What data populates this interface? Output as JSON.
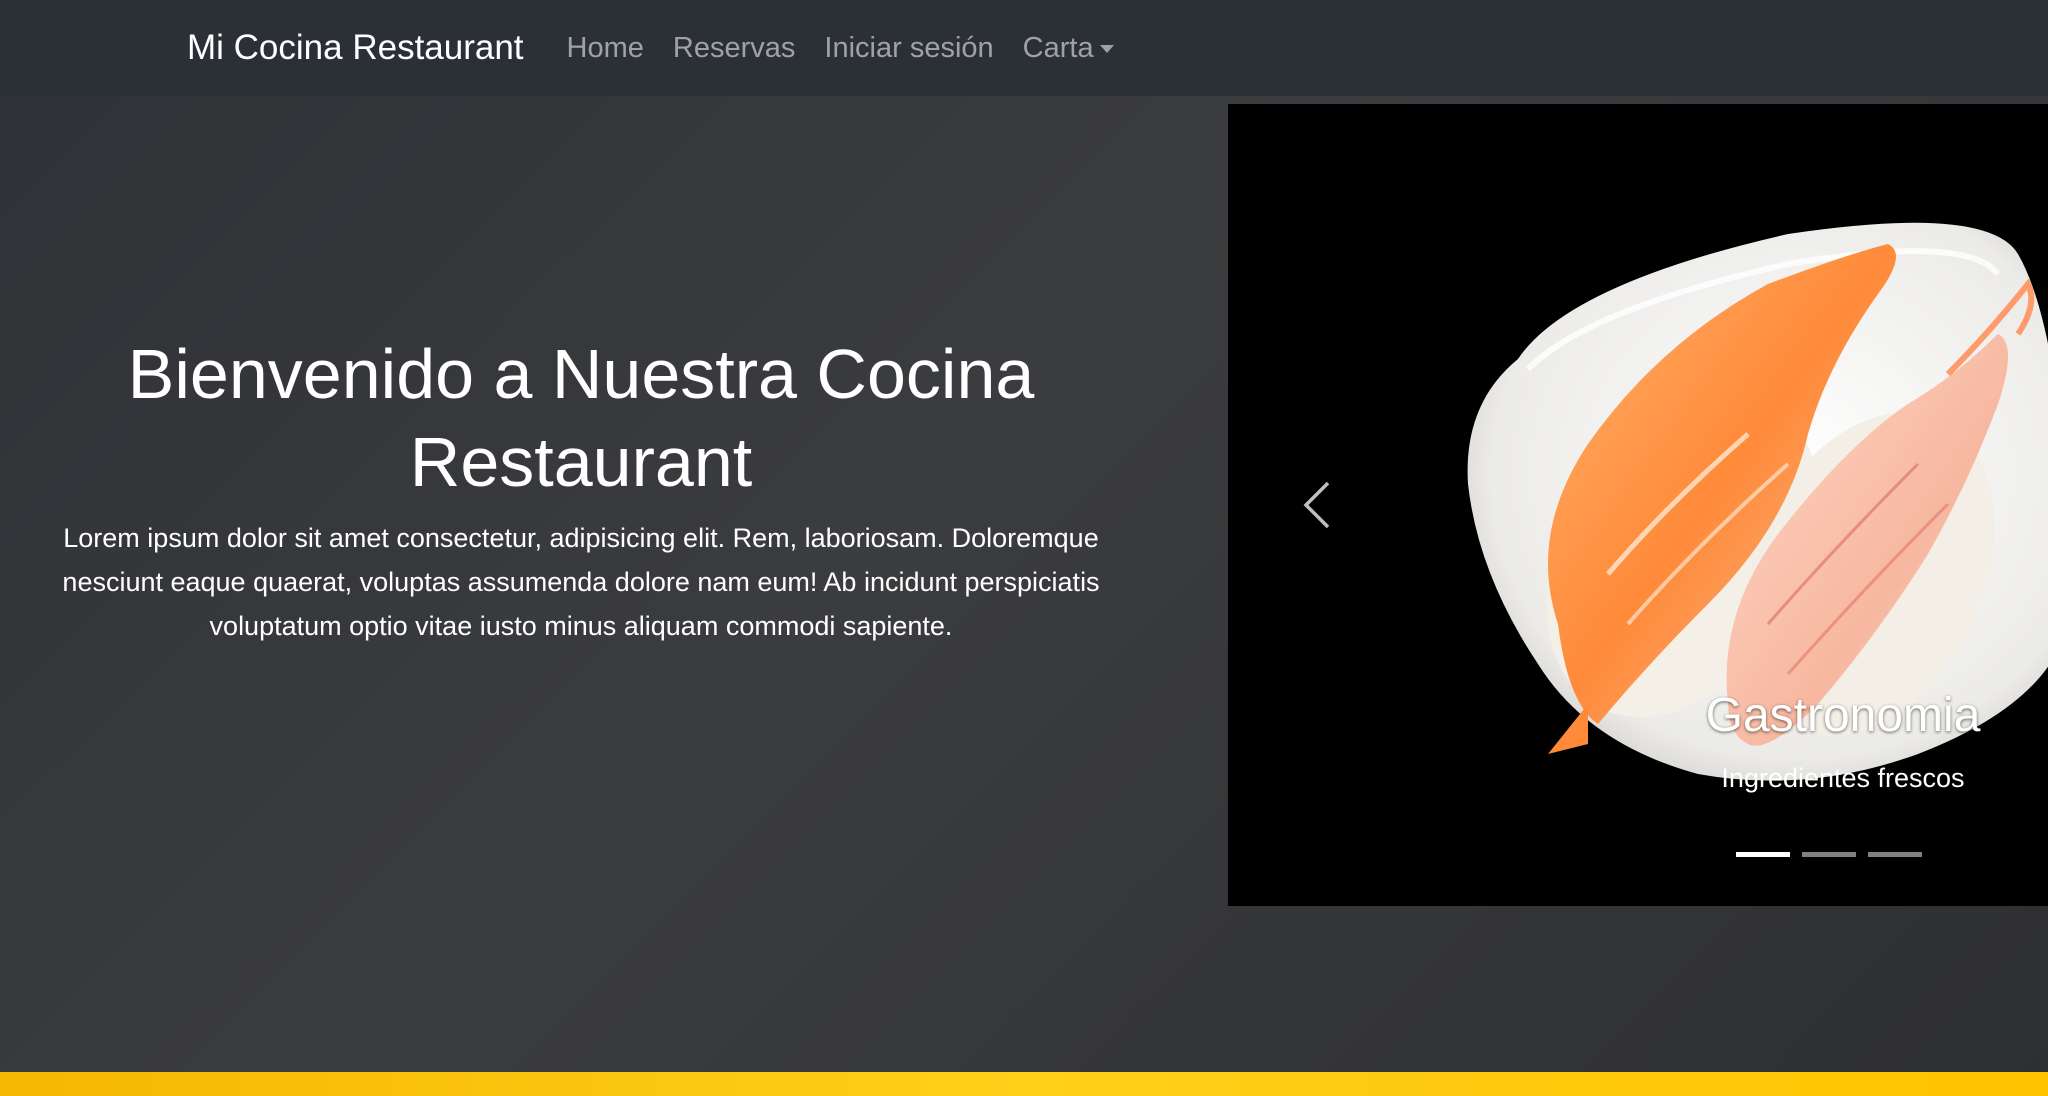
{
  "navbar": {
    "brand": "Mi Cocina Restaurant",
    "links": [
      {
        "label": "Home"
      },
      {
        "label": "Reservas"
      },
      {
        "label": "Iniciar sesión"
      },
      {
        "label": "Carta"
      }
    ]
  },
  "hero": {
    "title_line1": "Bienvenido a Nuestra Cocina",
    "title_line2": "Restaurant",
    "description_line1": "Lorem ipsum dolor sit amet consectetur, adipisicing elit. Rem, laboriosam. Doloremque",
    "description_line2": "nesciunt eaque quaerat, voluptas assumenda dolore nam eum! Ab incidunt perspiciatis",
    "description_line3": "voluptatum optio vitae iusto minus aliquam commodi sapiente."
  },
  "carousel": {
    "caption_title": "Gastronomia",
    "caption_subtitle": "Ingredientes frescos",
    "slide_count": 3,
    "active_index": 0
  },
  "icons": {
    "prev": "chevron-left-icon",
    "dropdown": "caret-down-icon"
  },
  "colors": {
    "navbar_bg": "#2b2f36",
    "page_bg": "#3a3b3e",
    "accent_strip": "#ffc400"
  }
}
